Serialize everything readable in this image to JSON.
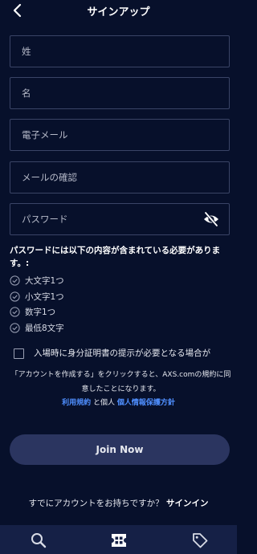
{
  "header": {
    "title": "サインアップ",
    "back_icon": "chevron-left-icon"
  },
  "form": {
    "last_name_placeholder": "姓",
    "first_name_placeholder": "名",
    "email_placeholder": "電子メール",
    "email_confirm_placeholder": "メールの確認",
    "password_placeholder": "パスワード",
    "password_toggle_icon": "eye-off-icon"
  },
  "password_requirements": {
    "title": "パスワードには以下の内容が含まれている必要があります。:",
    "items": [
      {
        "label": "大文字1つ",
        "icon": "check-circle-icon"
      },
      {
        "label": "小文字1つ",
        "icon": "check-circle-icon"
      },
      {
        "label": "数字1つ",
        "icon": "check-circle-icon"
      },
      {
        "label": "最低8文字",
        "icon": "check-circle-icon"
      }
    ]
  },
  "terms": {
    "checkbox_label": "入場時に身分証明書の提示が必要となる場合が",
    "consent_text": "「アカウントを作成する」をクリックすると、AXS.comの規約に同意したことになります。",
    "terms_link": "利用規約",
    "and_text": "と個人",
    "privacy_link": "個人情報保護方針"
  },
  "actions": {
    "join_now": "Join Now",
    "have_account": "すでにアカウントをお持ちですか？",
    "sign_in": "サインイン"
  },
  "tabbar": {
    "items": [
      {
        "icon": "search-icon"
      },
      {
        "icon": "ticket-icon"
      },
      {
        "icon": "tag-icon"
      }
    ]
  },
  "colors": {
    "background": "#07102b",
    "field_border": "#3a4466",
    "link": "#4f8fff",
    "button": "#2b3560",
    "tabbar": "#152046"
  }
}
